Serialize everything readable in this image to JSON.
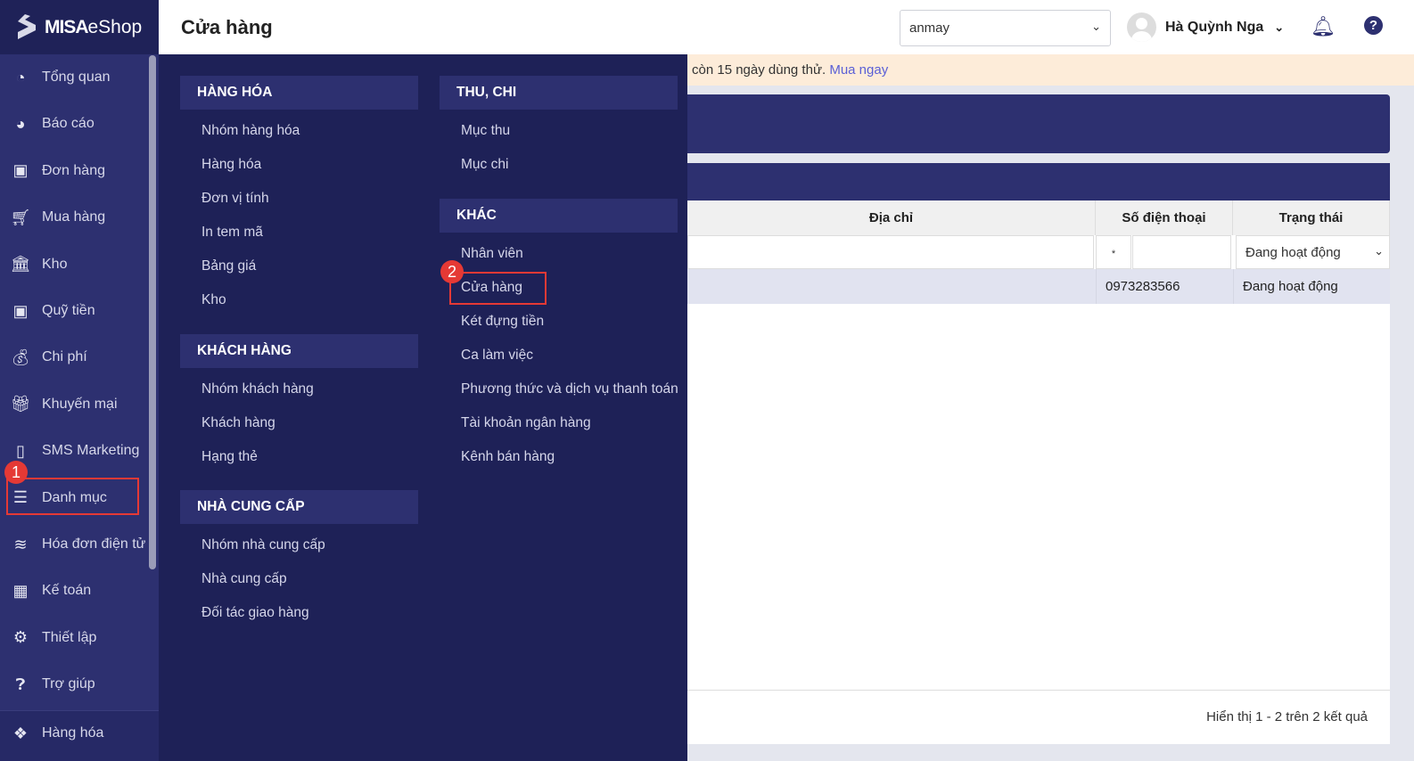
{
  "brand": {
    "logo_text_bold": "MISA",
    "logo_text": "eShop"
  },
  "sidebar": {
    "items": [
      {
        "label": "Tổng quan",
        "icon": "dashboard-icon"
      },
      {
        "label": "Báo cáo",
        "icon": "pie-chart-icon"
      },
      {
        "label": "Đơn hàng",
        "icon": "order-icon"
      },
      {
        "label": "Mua hàng",
        "icon": "cart-icon"
      },
      {
        "label": "Kho",
        "icon": "warehouse-icon"
      },
      {
        "label": "Quỹ tiền",
        "icon": "safe-icon"
      },
      {
        "label": "Chi phí",
        "icon": "money-bag-icon"
      },
      {
        "label": "Khuyến mại",
        "icon": "gift-icon"
      },
      {
        "label": "SMS Marketing",
        "icon": "phone-icon"
      },
      {
        "label": "Danh mục",
        "icon": "list-icon"
      },
      {
        "label": "Hóa đơn điện tử",
        "icon": "invoice-icon"
      },
      {
        "label": "Kế toán",
        "icon": "calculator-icon"
      },
      {
        "label": "Thiết lập",
        "icon": "gear-icon"
      },
      {
        "label": "Trợ giúp",
        "icon": "help-icon"
      }
    ],
    "bottom_item": {
      "label": "Hàng hóa",
      "icon": "boxes-icon"
    }
  },
  "header": {
    "title": "Cửa hàng",
    "store_select": "anmay",
    "user_name": "Hà Quỳnh Nga",
    "help": "?"
  },
  "banner": {
    "text": "còn 15 ngày dùng thử. ",
    "link": "Mua ngay"
  },
  "menu": {
    "col1": [
      {
        "header": "HÀNG HÓA",
        "items": [
          "Nhóm hàng hóa",
          "Hàng hóa",
          "Đơn vị tính",
          "In tem mã",
          "Bảng giá",
          "Kho"
        ]
      },
      {
        "header": "KHÁCH HÀNG",
        "items": [
          "Nhóm khách hàng",
          "Khách hàng",
          "Hạng thẻ"
        ]
      },
      {
        "header": "NHÀ CUNG CẤP",
        "items": [
          "Nhóm nhà cung cấp",
          "Nhà cung cấp",
          "Đối tác giao hàng"
        ]
      }
    ],
    "col2": [
      {
        "header": "THU, CHI",
        "items": [
          "Mục thu",
          "Mục chi"
        ]
      },
      {
        "header": "KHÁC",
        "items": [
          "Nhân viên",
          "Cửa hàng",
          "Két đựng tiền",
          "Ca làm việc",
          "Phương thức và dịch vụ thanh toán",
          "Tài khoản ngân hàng",
          "Kênh bán hàng"
        ]
      }
    ]
  },
  "table": {
    "columns": [
      "Địa chỉ",
      "Số điện thoại",
      "Trạng thái"
    ],
    "filters": {
      "phone_op": "*",
      "status": "Đang hoạt động"
    },
    "rows": [
      {
        "address": "",
        "phone": "0973283566",
        "status": "Đang hoạt động"
      }
    ],
    "footer": "Hiển thị 1 - 2 trên 2 kết quả"
  },
  "annotations": {
    "step1": "1",
    "step2": "2",
    "color": "#e53935"
  }
}
